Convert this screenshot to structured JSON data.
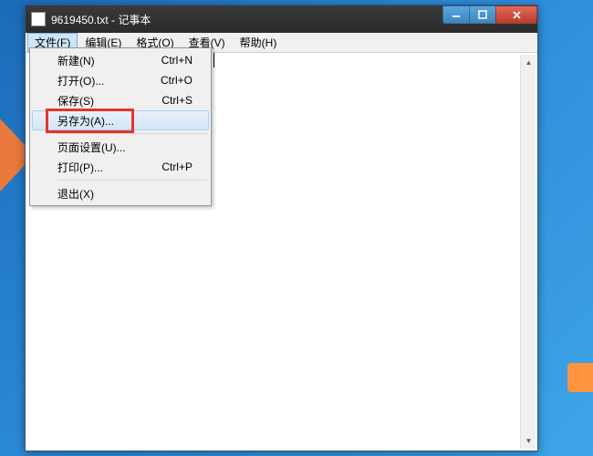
{
  "window": {
    "title": "9619450.txt - 记事本"
  },
  "menubar": {
    "items": [
      {
        "label": "文件(F)",
        "active": true
      },
      {
        "label": "编辑(E)",
        "active": false
      },
      {
        "label": "格式(O)",
        "active": false
      },
      {
        "label": "查看(V)",
        "active": false
      },
      {
        "label": "帮助(H)",
        "active": false
      }
    ]
  },
  "dropdown": {
    "items": [
      {
        "label": "新建(N)",
        "shortcut": "Ctrl+N",
        "hover": false
      },
      {
        "label": "打开(O)...",
        "shortcut": "Ctrl+O",
        "hover": false
      },
      {
        "label": "保存(S)",
        "shortcut": "Ctrl+S",
        "hover": false
      },
      {
        "label": "另存为(A)...",
        "shortcut": "",
        "hover": true,
        "highlighted": true
      },
      {
        "type": "separator"
      },
      {
        "label": "页面设置(U)...",
        "shortcut": "",
        "hover": false
      },
      {
        "label": "打印(P)...",
        "shortcut": "Ctrl+P",
        "hover": false
      },
      {
        "type": "separator"
      },
      {
        "label": "退出(X)",
        "shortcut": "",
        "hover": false
      }
    ]
  }
}
